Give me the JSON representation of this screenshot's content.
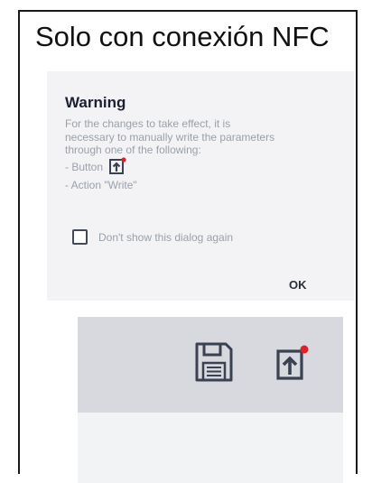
{
  "caption": "Solo con conexión NFC",
  "dialog": {
    "title": "Warning",
    "body_lines": [
      "For the changes to take effect, it is",
      "necessary to manually write the parameters",
      "through one of the following:"
    ],
    "option_button": "- Button",
    "option_action": "- Action \"Write\"",
    "checkbox_label": "Don't show this dialog again",
    "checkbox_checked": false,
    "ok_label": "OK"
  },
  "toolbar": {
    "icons": [
      "save-icon",
      "write-to-device-icon"
    ],
    "badge_color": "#e0202a"
  }
}
